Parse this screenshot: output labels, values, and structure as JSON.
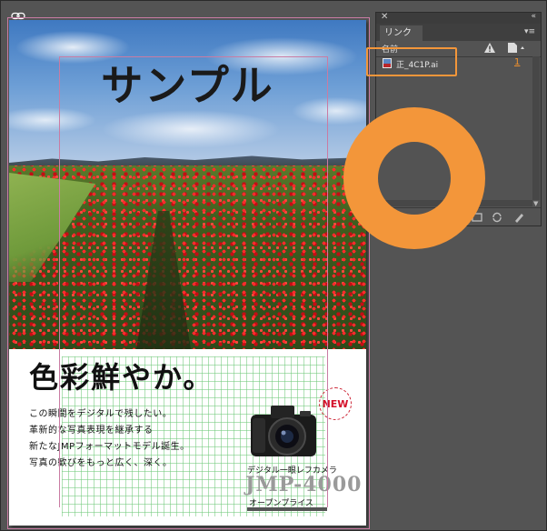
{
  "document": {
    "photo_title": "サンプル",
    "headline": "色彩鮮やか。",
    "body_lines": [
      "この瞬間をデジタルで残したい。",
      "革新的な写真表現を継承する",
      "新たなJMPフォーマットモデル誕生。",
      "写真の歓びをもっと広く、深く。"
    ],
    "badge": "NEW",
    "camera_sub": "デジタル一眼レフカメラ",
    "camera_model": "JMP-4000",
    "camera_price": "オープンプライス"
  },
  "links_panel": {
    "tab_label": "リンク",
    "column_name": "名前",
    "items": [
      {
        "name": "正_4C1P.ai",
        "page": "1"
      }
    ]
  },
  "colors": {
    "callout": "#f3963a",
    "guide": "#c97ca3",
    "panel_bg": "#535353",
    "canvas_bg": "#545454"
  },
  "icons": [
    "link-chain-icon",
    "close-icon",
    "collapse-icon",
    "panel-menu-icon",
    "warning-icon",
    "page-icon",
    "relink-icon",
    "update-link-icon",
    "edit-original-icon"
  ]
}
